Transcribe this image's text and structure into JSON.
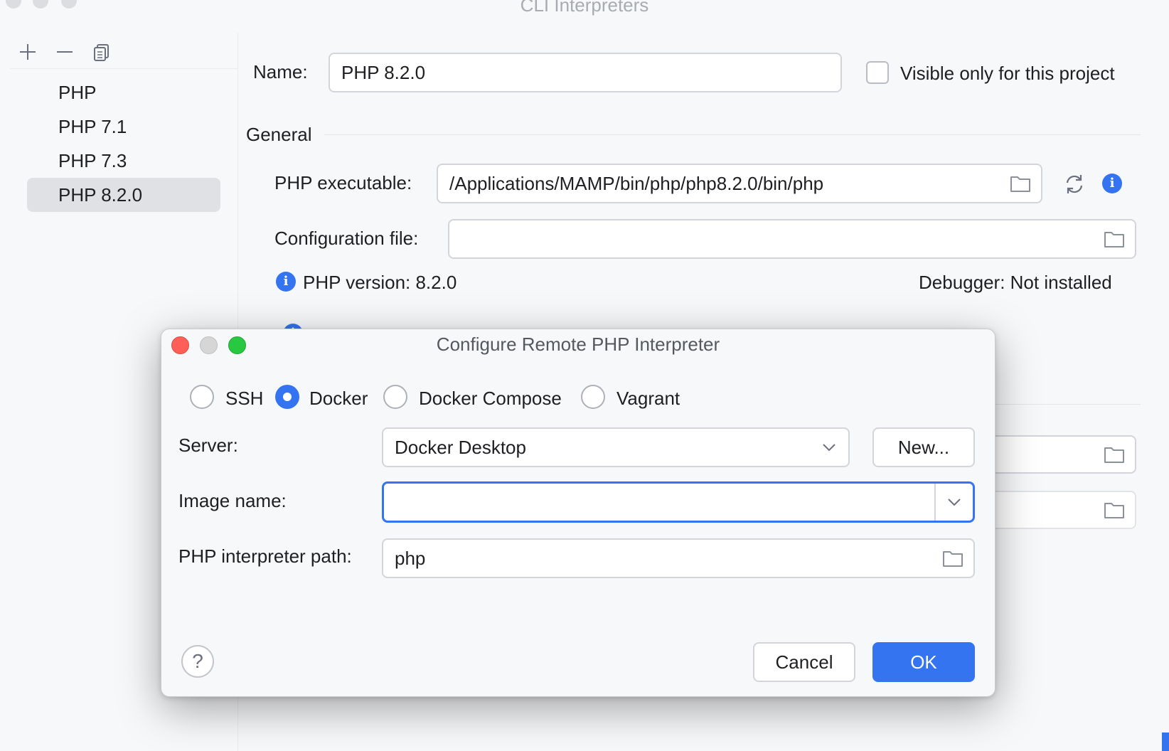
{
  "window": {
    "title": "CLI Interpreters"
  },
  "toolbar": {
    "add_icon": "plus-icon",
    "remove_icon": "minus-icon",
    "copy_icon": "copy-icon"
  },
  "interpreters": {
    "items": [
      {
        "label": "PHP"
      },
      {
        "label": "PHP 7.1"
      },
      {
        "label": "PHP 7.3"
      },
      {
        "label": "PHP 8.2.0",
        "selected": true
      }
    ]
  },
  "details": {
    "name_label": "Name:",
    "name_value": "PHP 8.2.0",
    "visible_only_label": "Visible only for this project",
    "visible_only_checked": false,
    "general_header": "General",
    "executable_label": "PHP executable:",
    "executable_value": "/Applications/MAMP/bin/php/php8.2.0/bin/php",
    "config_label": "Configuration file:",
    "config_value": "",
    "php_version": "PHP version: 8.2.0",
    "debugger_label": "Debugger:",
    "debugger_value": "Not installed"
  },
  "dialog": {
    "title": "Configure Remote PHP Interpreter",
    "options": [
      {
        "label": "SSH",
        "checked": false
      },
      {
        "label": "Docker",
        "checked": true
      },
      {
        "label": "Docker Compose",
        "checked": false
      },
      {
        "label": "Vagrant",
        "checked": false
      }
    ],
    "server_label": "Server:",
    "server_value": "Docker Desktop",
    "new_button": "New...",
    "image_label": "Image name:",
    "image_value": "",
    "path_label": "PHP interpreter path:",
    "path_value": "php",
    "help_button": "?",
    "cancel_button": "Cancel",
    "ok_button": "OK"
  },
  "colors": {
    "accent": "#3574f0",
    "close": "#ff5f57",
    "minimize": "#d6d6d6",
    "zoom": "#28c840"
  }
}
